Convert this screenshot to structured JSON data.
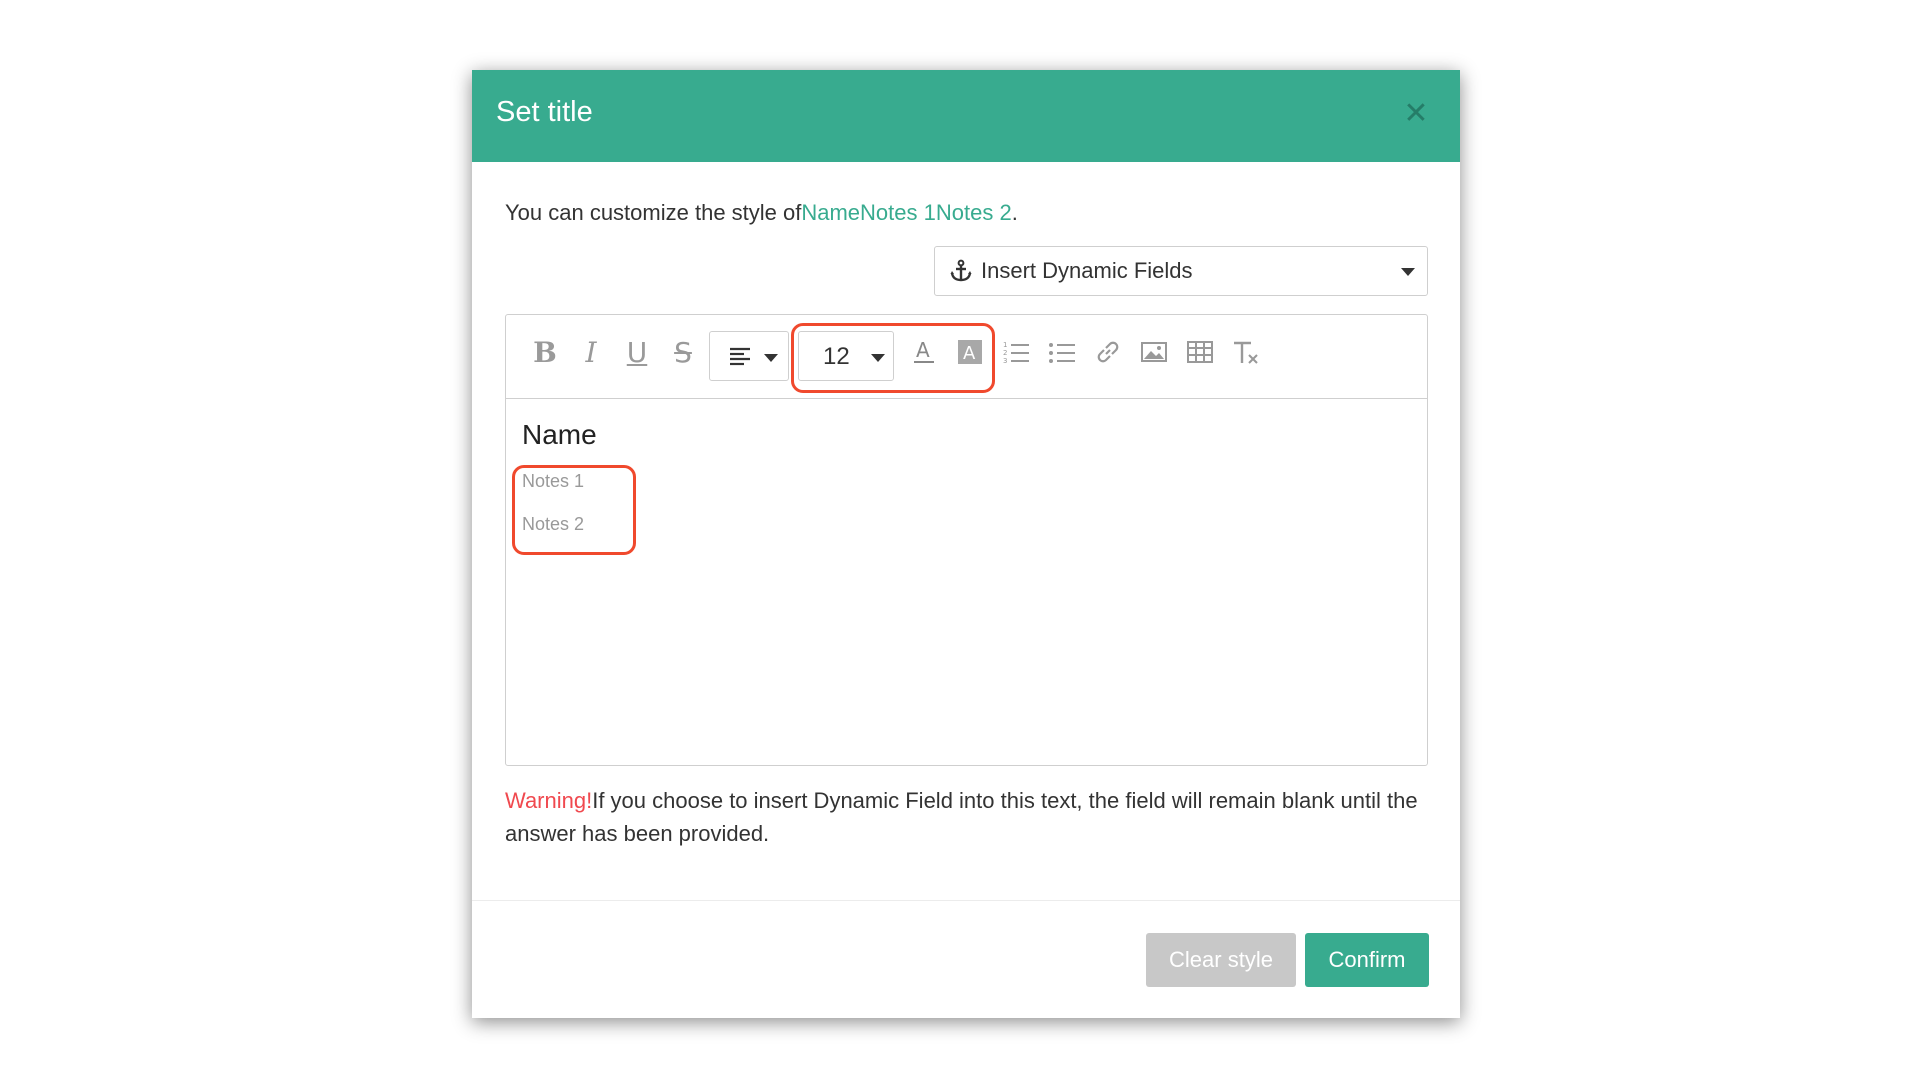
{
  "dialog": {
    "title": "Set title",
    "close_icon": "close-icon",
    "intro_prefix": "You can customize the style of",
    "intro_fields": "NameNotes 1Notes 2",
    "intro_suffix": "."
  },
  "dynamic_fields": {
    "label": "Insert Dynamic Fields",
    "icon": "anchor-icon"
  },
  "toolbar": {
    "bold": "B",
    "italic": "I",
    "underline": "U",
    "strike": "S",
    "align_icon": "align-left-icon",
    "font_size": "12",
    "font_color_icon": "font-color-icon",
    "bg_color_icon": "background-color-icon",
    "ordered_list_icon": "ordered-list-icon",
    "bullet_list_icon": "bullet-list-icon",
    "link_icon": "link-icon",
    "image_icon": "image-icon",
    "table_icon": "table-icon",
    "clear_format_icon": "clear-format-icon"
  },
  "editor": {
    "lines": [
      {
        "text": "Name"
      },
      {
        "text": "Notes 1"
      },
      {
        "text": "Notes 2"
      }
    ]
  },
  "warning": {
    "label": "Warning!",
    "text": "If you choose to insert Dynamic Field into this text, the field will remain blank until the answer has been provided."
  },
  "footer": {
    "clear_label": "Clear style",
    "confirm_label": "Confirm"
  },
  "colors": {
    "accent": "#38ab8f",
    "warning": "#f0494f",
    "highlight": "#f0492d"
  }
}
